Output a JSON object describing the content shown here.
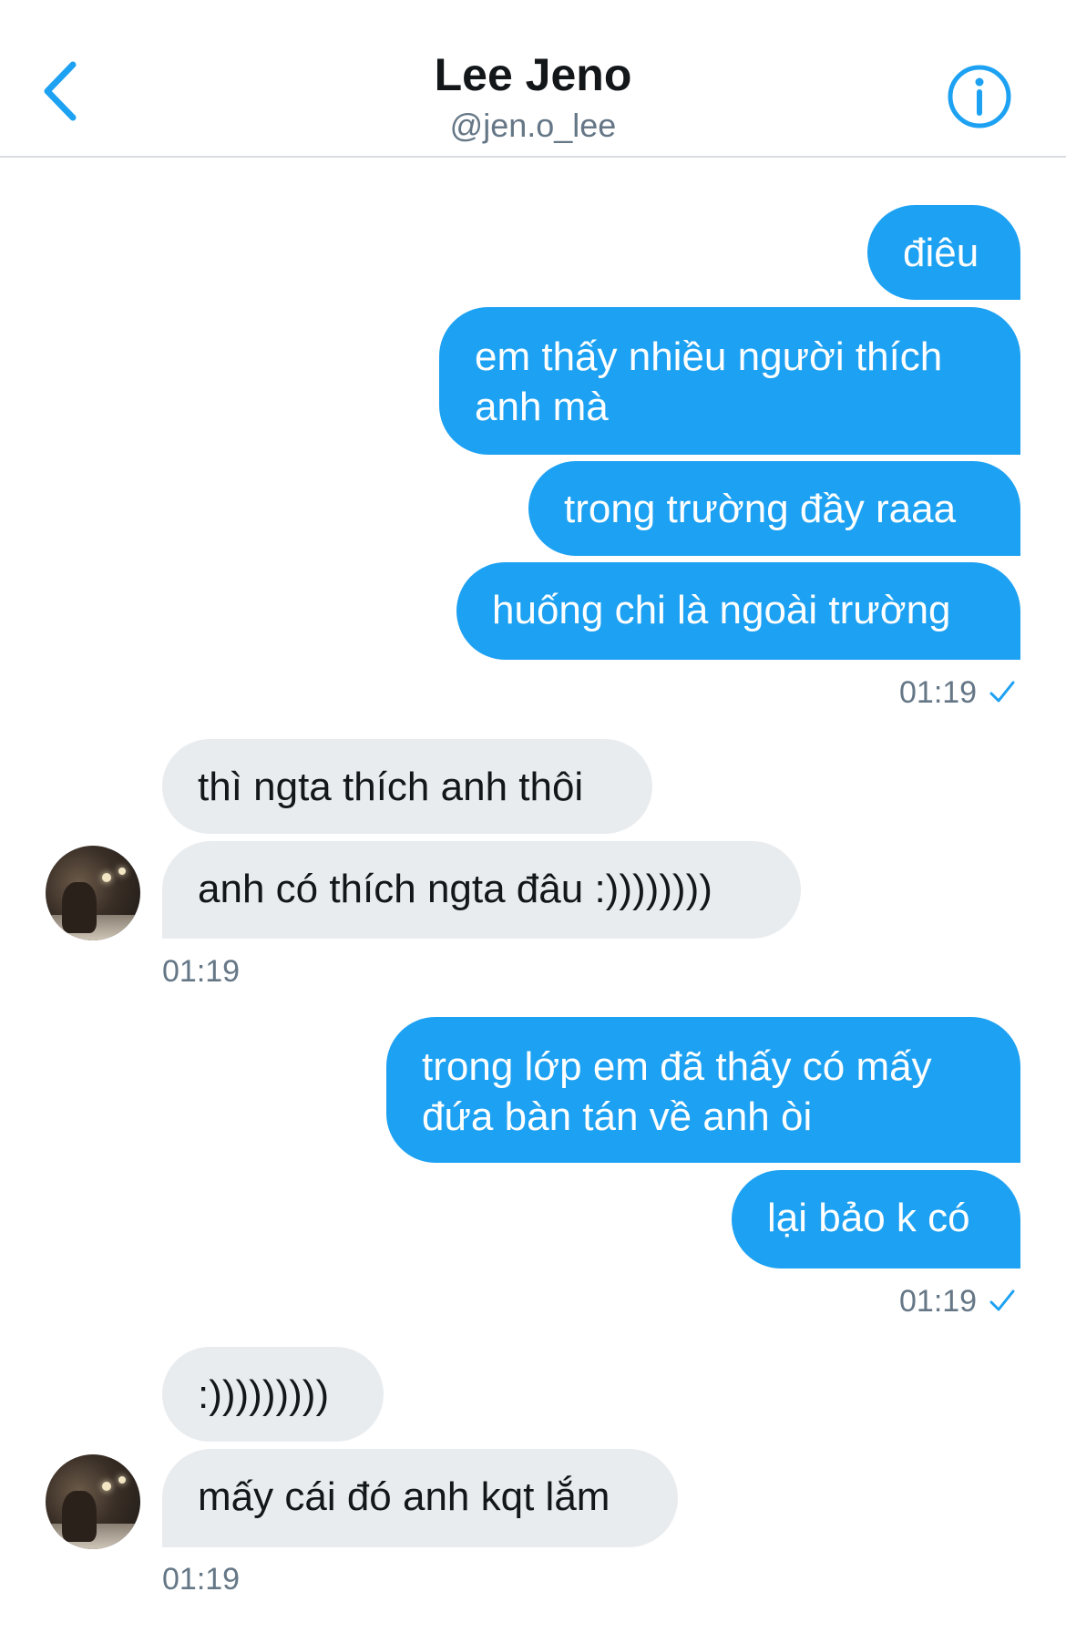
{
  "header": {
    "title": "Lee Jeno",
    "handle": "@jen.o_lee",
    "back_icon": "chevron-left-icon",
    "info_icon": "info-icon",
    "accent_color": "#1da1f2"
  },
  "messages": {
    "sent_1": "điêu",
    "sent_2": "em thấy nhiều người thích anh mà",
    "sent_3": "trong trường đầy raaa",
    "sent_4": "huống chi là ngoài trường",
    "sent_time_1": "01:19",
    "recv_1": "thì ngta thích anh thôi",
    "recv_2": "anh có thích ngta đâu :))))))))",
    "recv_time_1": "01:19",
    "sent_5": "trong lớp em đã thấy có mấy đứa bàn tán về anh òi",
    "sent_6": "lại bảo k có",
    "sent_time_2": "01:19",
    "recv_3": ":)))))))))",
    "recv_4": "mấy cái đó anh kqt lắm",
    "recv_time_2": "01:19"
  },
  "colors": {
    "sent_bubble": "#1da1f2",
    "received_bubble": "#e9ecef",
    "timestamp": "#657786"
  }
}
